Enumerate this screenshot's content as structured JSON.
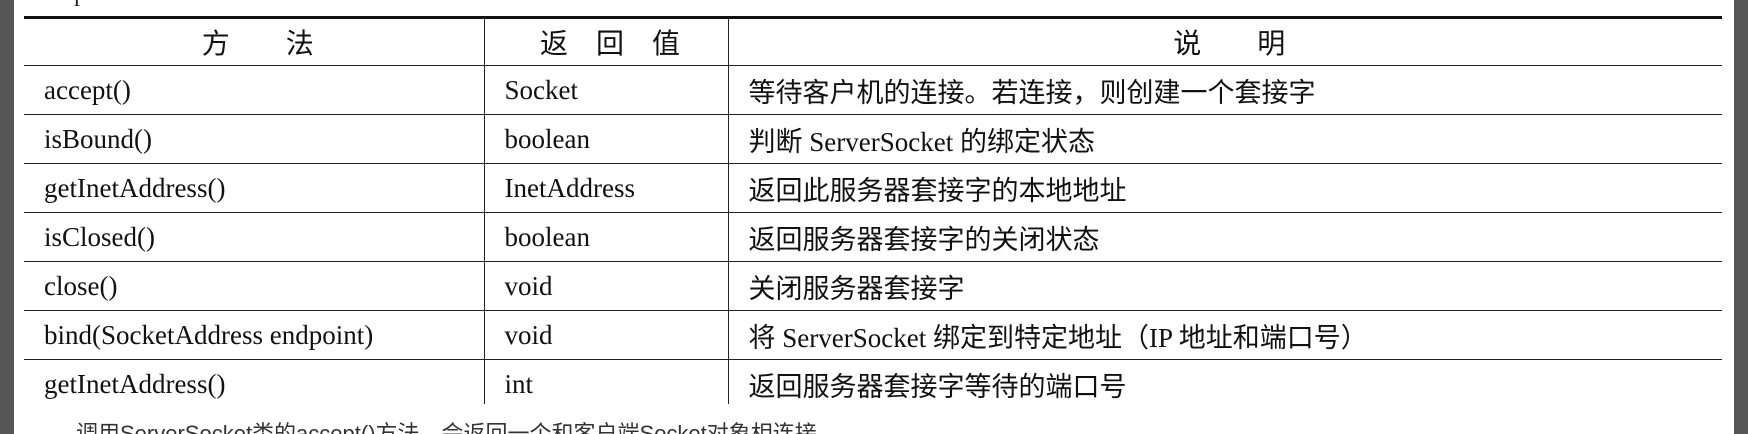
{
  "table": {
    "headers": [
      "方　　法",
      "返　回　值",
      "说　　明"
    ],
    "rows": [
      {
        "method": "accept()",
        "return": "Socket",
        "desc": "等待客户机的连接。若连接，则创建一个套接字"
      },
      {
        "method": "isBound()",
        "return": "boolean",
        "desc": "判断 ServerSocket 的绑定状态"
      },
      {
        "method": "getInetAddress()",
        "return": "InetAddress",
        "desc": "返回此服务器套接字的本地地址"
      },
      {
        "method": "isClosed()",
        "return": "boolean",
        "desc": "返回服务器套接字的关闭状态"
      },
      {
        "method": "close()",
        "return": "void",
        "desc": "关闭服务器套接字"
      },
      {
        "method": "bind(SocketAddress endpoint)",
        "return": "void",
        "desc": "将 ServerSocket 绑定到特定地址（IP 地址和端口号）"
      },
      {
        "method": "getInetAddress()",
        "return": "int",
        "desc": "返回服务器套接字等待的端口号"
      }
    ]
  },
  "fragments": {
    "top": "r",
    "bottom": "调用ServerSocket类的accept()方法，会返回一个和客户端Socket对象相连接"
  }
}
